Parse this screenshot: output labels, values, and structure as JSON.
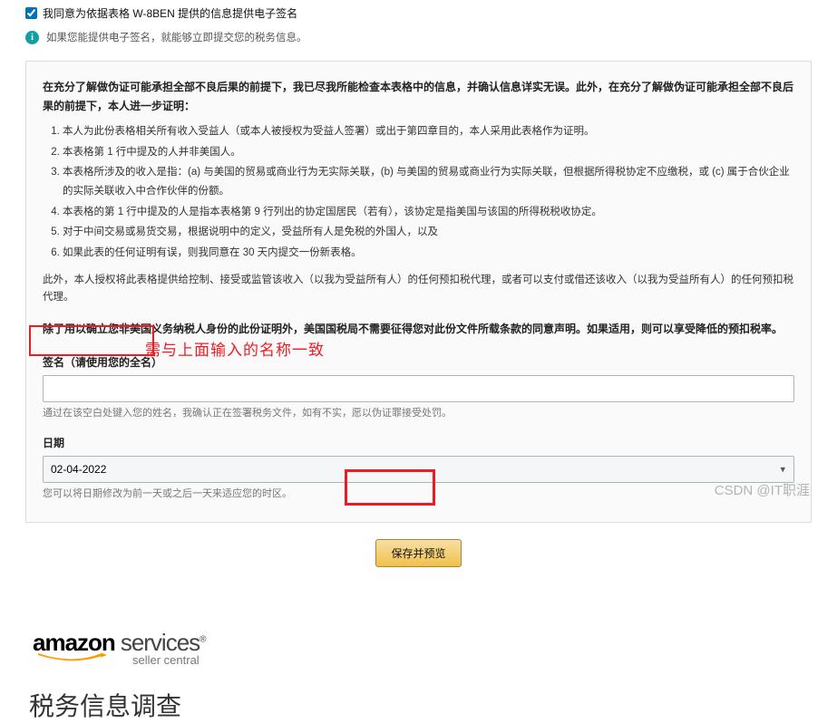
{
  "consent": {
    "label": "我同意为依据表格 W-8BEN 提供的信息提供电子签名",
    "checked": true
  },
  "hint": "如果您能提供电子签名，就能够立即提交您的税务信息。",
  "cert": {
    "intro": "在充分了解做伪证可能承担全部不良后果的前提下，我已尽我所能检查本表格中的信息，并确认信息详实无误。此外，在充分了解做伪证可能承担全部不良后果的前提下，本人进一步证明：",
    "items": [
      "本人为此份表格相关所有收入受益人（或本人被授权为受益人签署）或出于第四章目的，本人采用此表格作为证明。",
      "本表格第 1 行中提及的人并非美国人。",
      "本表格所涉及的收入是指：(a) 与美国的贸易或商业行为无实际关联，(b) 与美国的贸易或商业行为实际关联，但根据所得税协定不应缴税，或 (c) 属于合伙企业的实际关联收入中合作伙伴的份额。",
      "本表格的第 1 行中提及的人是指本表格第 9 行列出的协定国居民（若有），该协定是指美国与该国的所得税税收协定。",
      "对于中间交易或易货交易，根据说明中的定义，受益所有人是免税的外国人，以及",
      "如果此表的任何证明有误，则我同意在 30 天内提交一份新表格。"
    ],
    "auth": "此外，本人授权将此表格提供给控制、接受或监管该收入（以我为受益所有人）的任何预扣税代理，或者可以支付或借还该收入（以我为受益所有人）的任何预扣税代理。",
    "irs": "除了用以确立您非美国义务纳税人身份的此份证明外，美国国税局不需要征得您对此份文件所载条款的同意声明。如果适用，则可以享受降低的预扣税率。"
  },
  "signature": {
    "label": "签名（请使用您的全名）",
    "value": "",
    "hint_prefix": "通过在该空白处键入您的姓名",
    "hint_rest": "，我确认正在签署税务文件，如有不实，愿以伪证罪接受处罚。",
    "annotation": "需与上面输入的名称一致"
  },
  "date": {
    "label": "日期",
    "value": "02-04-2022",
    "hint": "您可以将日期修改为前一天或之后一天来适应您的时区。"
  },
  "button": {
    "save": "保存并预览"
  },
  "watermark": "CSDN @IT职涯",
  "footer": {
    "logo_main": "amazon",
    "logo_sub": "services",
    "seller": "seller central",
    "title": "税务信息调查"
  }
}
